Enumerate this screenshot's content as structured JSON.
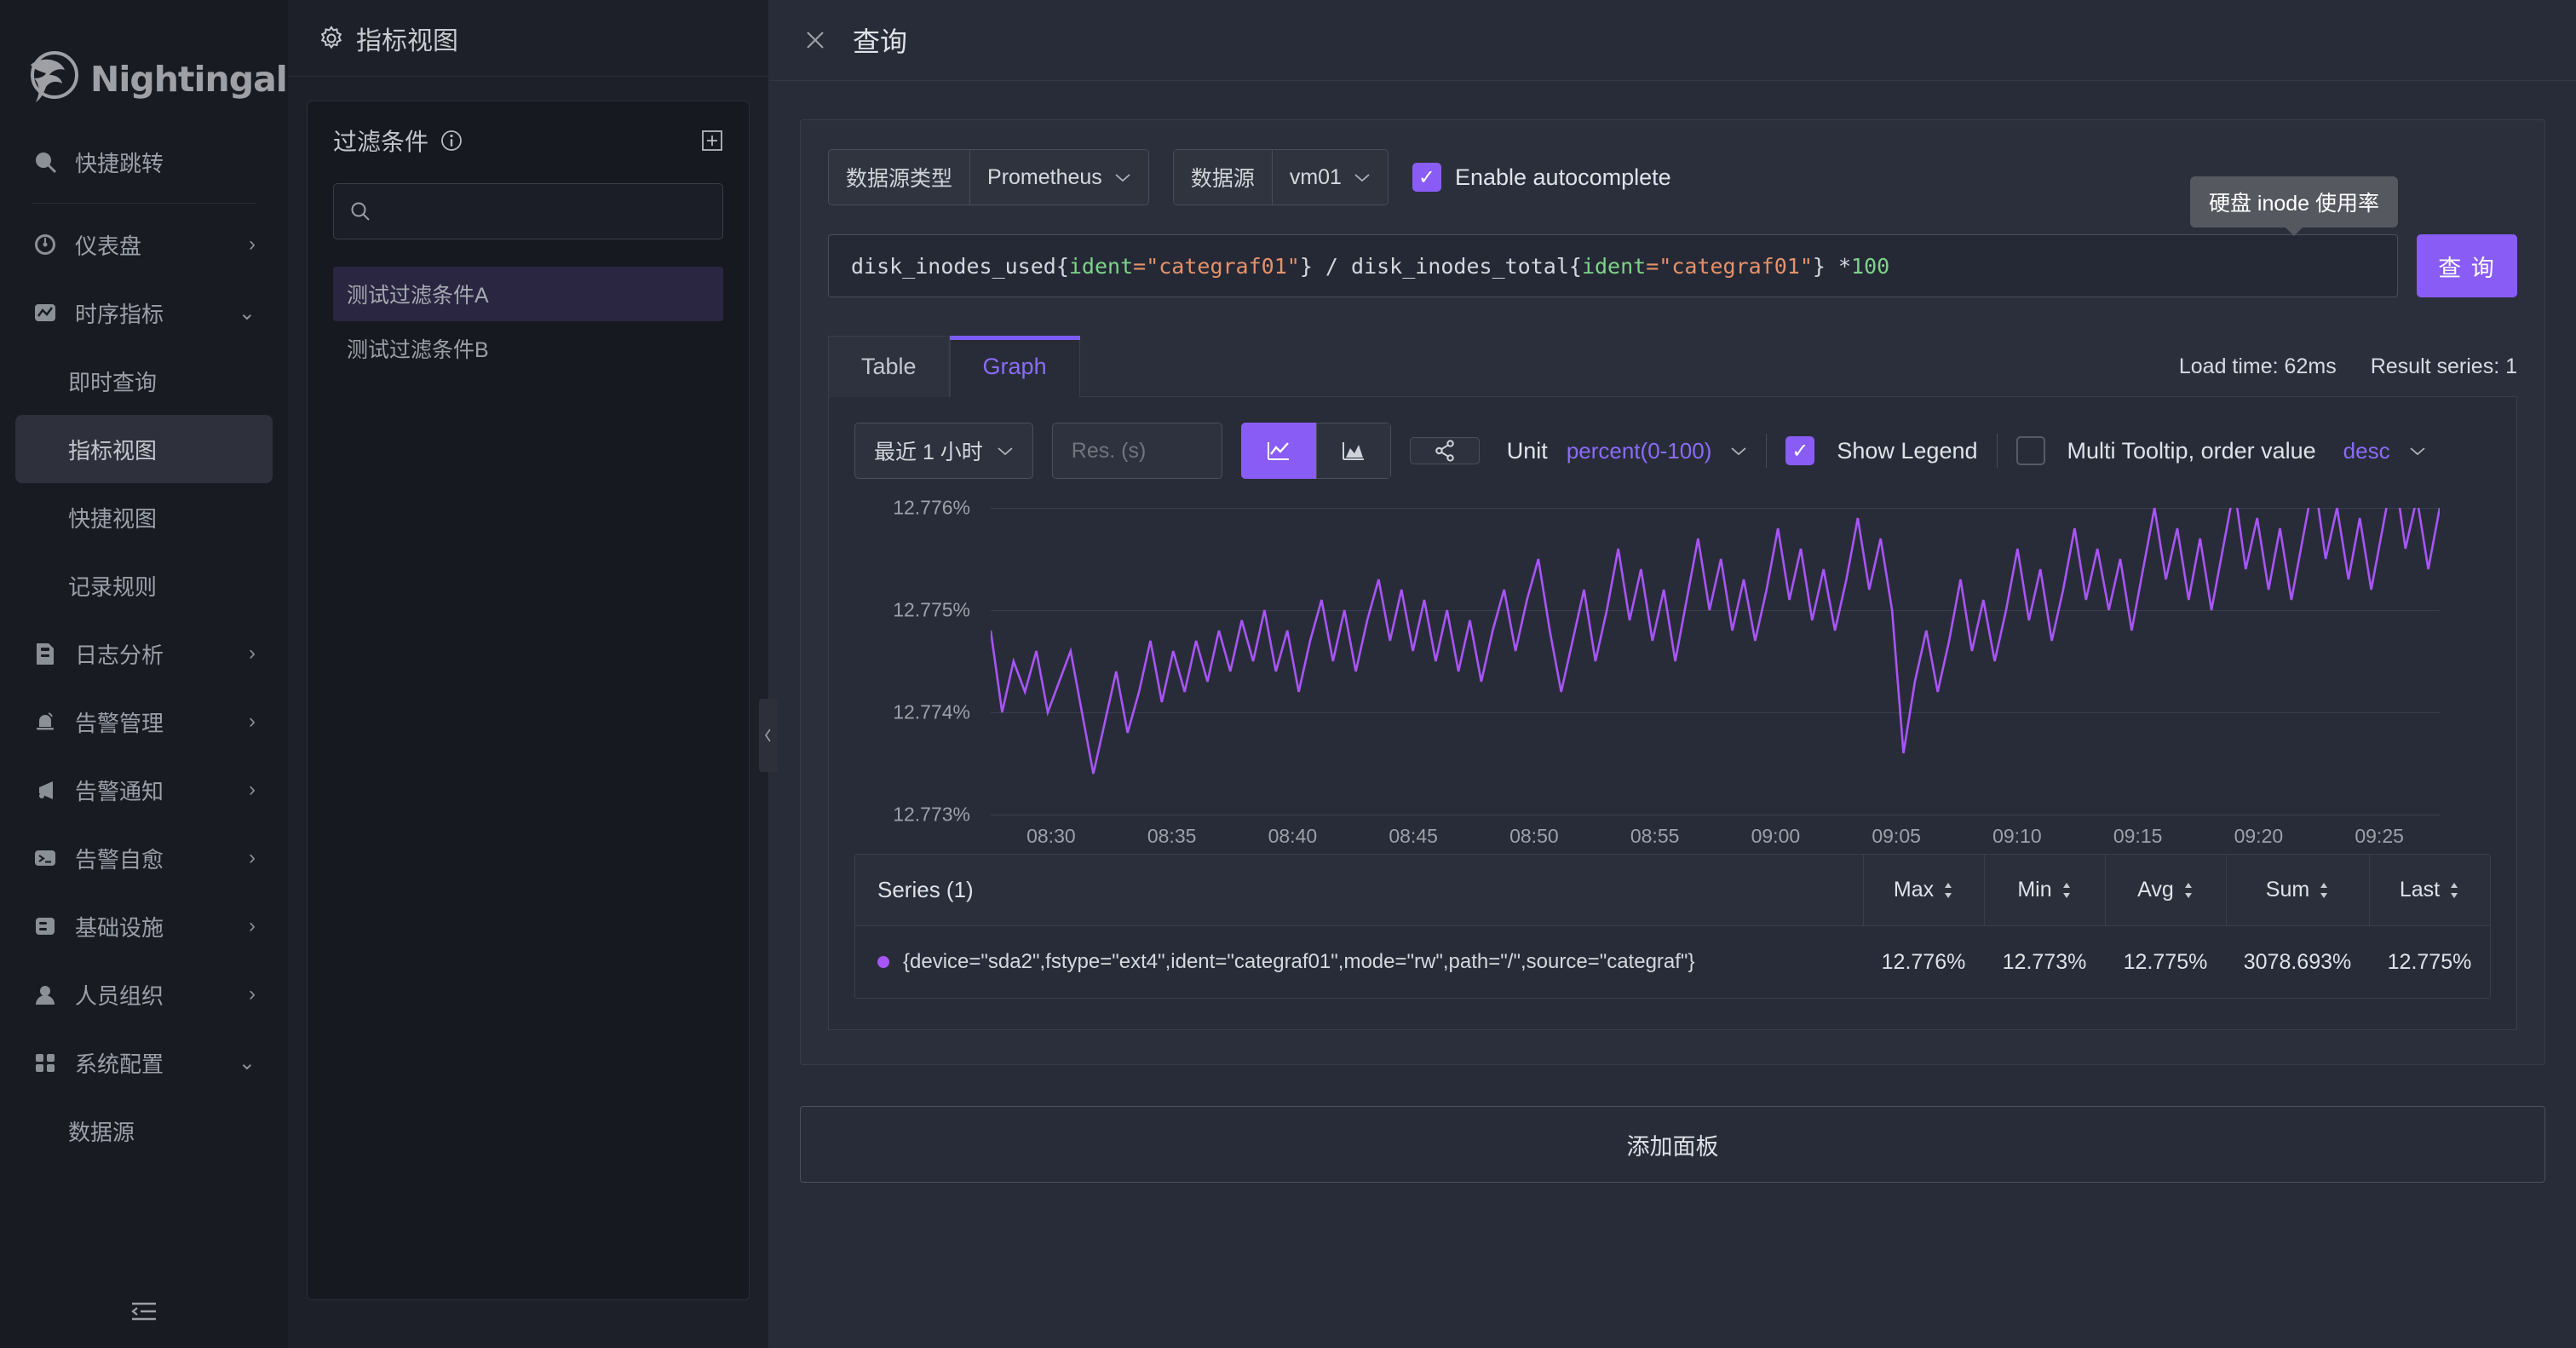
{
  "brand": {
    "name": "Nightingale",
    "logo_icon": "nightingale-bird-logo"
  },
  "sidebar": {
    "items": [
      {
        "label": "快捷跳转",
        "icon": "search-icon",
        "type": "top",
        "chevron": ""
      },
      {
        "label": "仪表盘",
        "icon": "dashboard-gauge-icon",
        "type": "top",
        "chevron": "›"
      },
      {
        "label": "时序指标",
        "icon": "timeseries-chart-icon",
        "type": "top",
        "chevron": "⌄"
      },
      {
        "label": "即时查询",
        "icon": "",
        "type": "sub",
        "chevron": ""
      },
      {
        "label": "指标视图",
        "icon": "",
        "type": "sub",
        "chevron": "",
        "active": true
      },
      {
        "label": "快捷视图",
        "icon": "",
        "type": "sub",
        "chevron": ""
      },
      {
        "label": "记录规则",
        "icon": "",
        "type": "sub",
        "chevron": ""
      },
      {
        "label": "日志分析",
        "icon": "log-document-icon",
        "type": "top",
        "chevron": "›"
      },
      {
        "label": "告警管理",
        "icon": "alert-bell-icon",
        "type": "top",
        "chevron": "›"
      },
      {
        "label": "告警通知",
        "icon": "megaphone-icon",
        "type": "top",
        "chevron": "›"
      },
      {
        "label": "告警自愈",
        "icon": "terminal-icon",
        "type": "top",
        "chevron": "›"
      },
      {
        "label": "基础设施",
        "icon": "server-icon",
        "type": "top",
        "chevron": "›"
      },
      {
        "label": "人员组织",
        "icon": "user-icon",
        "type": "top",
        "chevron": "›"
      },
      {
        "label": "系统配置",
        "icon": "grid-settings-icon",
        "type": "top",
        "chevron": "⌄"
      },
      {
        "label": "数据源",
        "icon": "",
        "type": "sub",
        "chevron": ""
      }
    ],
    "collapse_icon": "menu-collapse-icon"
  },
  "midpanel": {
    "header_title": "指标视图",
    "header_icon": "gear-icon",
    "filter_title": "过滤条件",
    "info_icon": "info-circle-icon",
    "add_icon": "add-box-icon",
    "search_placeholder": "",
    "search_icon": "search-icon",
    "items": [
      {
        "label": "测试过滤条件A",
        "selected": true
      },
      {
        "label": "测试过滤条件B",
        "selected": false
      }
    ],
    "collapse_icon": "chevron-left-icon"
  },
  "main": {
    "close_icon": "close-icon",
    "title": "查询",
    "datasource_type_label": "数据源类型",
    "datasource_type_value": "Prometheus",
    "datasource_label": "数据源",
    "datasource_value": "vm01",
    "autocomplete_label": "Enable autocomplete",
    "autocomplete_checked": true,
    "query_tokens": [
      {
        "text": "disk_inodes_used{",
        "cls": "t-white"
      },
      {
        "text": "ident",
        "cls": "t-green"
      },
      {
        "text": "=\"categraf01\"",
        "cls": "t-orange"
      },
      {
        "text": "} / disk_inodes_total{",
        "cls": "t-white"
      },
      {
        "text": "ident",
        "cls": "t-green"
      },
      {
        "text": "=\"categraf01\"",
        "cls": "t-orange"
      },
      {
        "text": "} * ",
        "cls": "t-white"
      },
      {
        "text": "100",
        "cls": "t-green"
      }
    ],
    "query_button": "查 询",
    "tooltip": "硬盘 inode 使用率",
    "tabs": [
      {
        "label": "Table",
        "active": false
      },
      {
        "label": "Graph",
        "active": true
      }
    ],
    "load_time": "Load time: 62ms",
    "result_series": "Result series: 1",
    "time_range": "最近 1 小时",
    "res_placeholder": "Res. (s)",
    "chart_type_line_icon": "line-chart-icon",
    "chart_type_area_icon": "area-chart-icon",
    "share_icon": "share-nodes-icon",
    "unit_label": "Unit",
    "unit_value": "percent(0-100)",
    "show_legend_label": "Show Legend",
    "show_legend_checked": true,
    "multi_tooltip_label": "Multi Tooltip, order value",
    "multi_tooltip_checked": false,
    "order_value": "desc",
    "series_title": "Series (1)",
    "columns": [
      "Max",
      "Min",
      "Avg",
      "Sum",
      "Last"
    ],
    "rows": [
      {
        "name": "{device=\"sda2\",fstype=\"ext4\",ident=\"categraf01\",mode=\"rw\",path=\"/\",source=\"categraf\"}",
        "color": "#a855f7",
        "values": [
          "12.776%",
          "12.773%",
          "12.775%",
          "3078.693%",
          "12.775%"
        ]
      }
    ],
    "add_panel": "添加面板",
    "accent_color": "#8a5cf6",
    "series_color": "#a855f7"
  },
  "chart_data": {
    "type": "line",
    "title": "",
    "xlabel": "",
    "ylabel": "",
    "ylim": [
      12.773,
      12.776
    ],
    "yticks": [
      "12.773%",
      "12.774%",
      "12.775%",
      "12.776%"
    ],
    "ytick_values": [
      12.773,
      12.774,
      12.775,
      12.776
    ],
    "xticks": [
      "08:30",
      "08:35",
      "08:40",
      "08:45",
      "08:50",
      "08:55",
      "09:00",
      "09:05",
      "09:10",
      "09:15",
      "09:20",
      "09:25"
    ],
    "grid": true,
    "legend": "bottom-table",
    "series": [
      {
        "name": "{device=\"sda2\",fstype=\"ext4\",ident=\"categraf01\",mode=\"rw\",path=\"/\",source=\"categraf\"}",
        "color": "#a855f7",
        "unit": "percent(0-100)",
        "max": 12.776,
        "min": 12.773,
        "avg": 12.775,
        "sum": 3078.693,
        "last": 12.775,
        "values": [
          12.7748,
          12.774,
          12.7745,
          12.7742,
          12.7746,
          12.774,
          12.7743,
          12.7746,
          12.774,
          12.7734,
          12.7739,
          12.7744,
          12.7738,
          12.7742,
          12.7747,
          12.7741,
          12.7746,
          12.7742,
          12.7747,
          12.7743,
          12.7748,
          12.7744,
          12.7749,
          12.7745,
          12.775,
          12.7744,
          12.7748,
          12.7742,
          12.7747,
          12.7751,
          12.7745,
          12.775,
          12.7744,
          12.7749,
          12.7753,
          12.7747,
          12.7752,
          12.7746,
          12.7751,
          12.7745,
          12.775,
          12.7744,
          12.7749,
          12.7743,
          12.7748,
          12.7752,
          12.7746,
          12.7751,
          12.7755,
          12.7748,
          12.7742,
          12.7747,
          12.7752,
          12.7745,
          12.775,
          12.7756,
          12.7749,
          12.7754,
          12.7747,
          12.7752,
          12.7745,
          12.7751,
          12.7757,
          12.775,
          12.7755,
          12.7748,
          12.7753,
          12.7747,
          12.7752,
          12.7758,
          12.7751,
          12.7756,
          12.7749,
          12.7754,
          12.7748,
          12.7753,
          12.7759,
          12.7752,
          12.7757,
          12.775,
          12.7736,
          12.7743,
          12.7748,
          12.7742,
          12.7747,
          12.7753,
          12.7746,
          12.7751,
          12.7745,
          12.775,
          12.7756,
          12.7749,
          12.7754,
          12.7747,
          12.7752,
          12.7758,
          12.7751,
          12.7756,
          12.775,
          12.7755,
          12.7748,
          12.7754,
          12.776,
          12.7753,
          12.7758,
          12.7751,
          12.7757,
          12.775,
          12.7756,
          12.7762,
          12.7754,
          12.7759,
          12.7752,
          12.7758,
          12.7751,
          12.7757,
          12.7763,
          12.7755,
          12.776,
          12.7753,
          12.7759,
          12.7752,
          12.7758,
          12.7764,
          12.7756,
          12.7761,
          12.7754,
          12.776
        ]
      }
    ]
  }
}
